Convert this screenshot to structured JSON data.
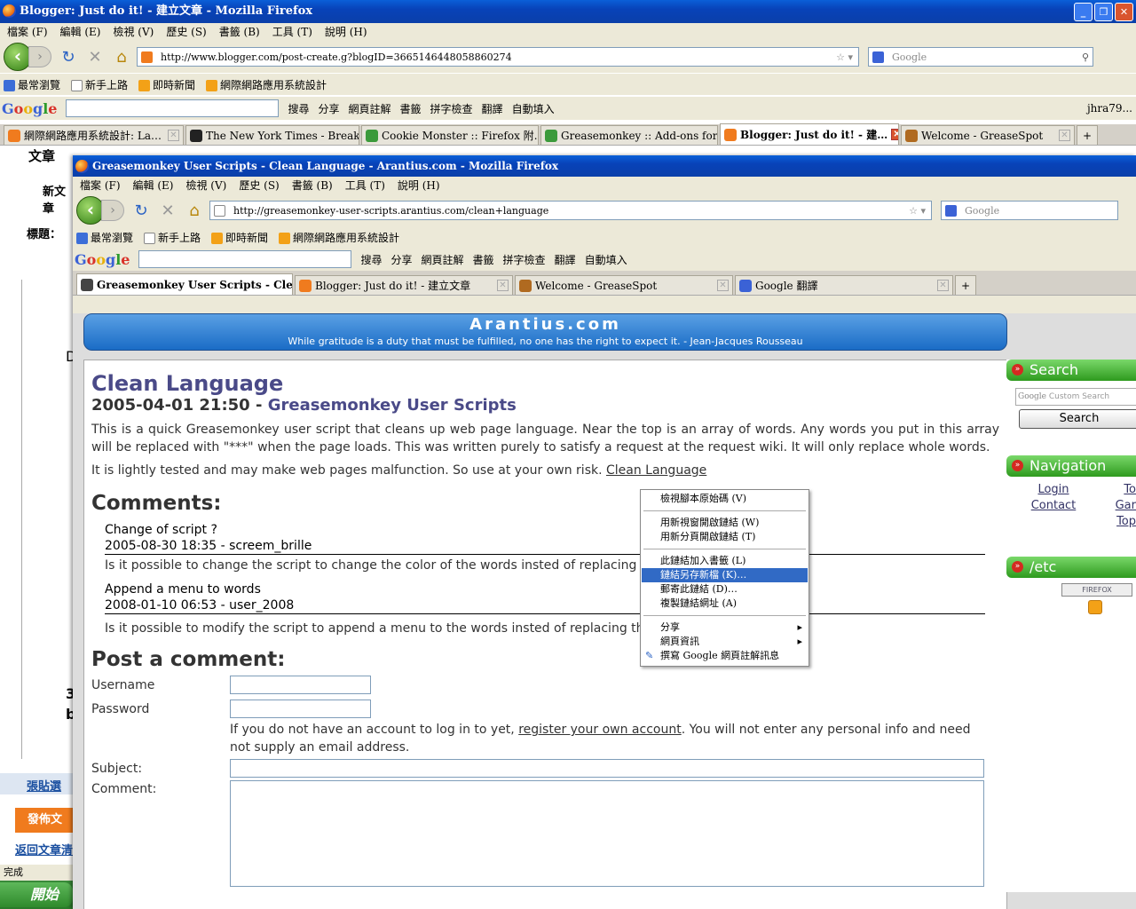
{
  "outer": {
    "title": "Blogger: Just do it! - 建立文章 - Mozilla Firefox",
    "menu": [
      "檔案 (F)",
      "編輯 (E)",
      "檢視 (V)",
      "歷史 (S)",
      "書籤 (B)",
      "工具 (T)",
      "說明 (H)"
    ],
    "url": "http://www.blogger.com/post-create.g?blogID=3665146448058860274",
    "search_placeholder": "Google",
    "bookmarks": [
      "最常瀏覽",
      "新手上路",
      "即時新聞",
      "網際網路應用系統設計"
    ],
    "gtoolbar": [
      "搜尋",
      "分享",
      "網頁註解",
      "書籤",
      "拼字檢查",
      "翻譯",
      "自動填入"
    ],
    "user": "jhra79...",
    "tabs": [
      {
        "label": "網際網路應用系統設計: La…",
        "color": "#f07b1e"
      },
      {
        "label": "The New York Times - Break…",
        "color": "#222222"
      },
      {
        "label": "Cookie Monster :: Firefox 附…",
        "color": "#3b9a3b"
      },
      {
        "label": "Greasemonkey :: Add-ons for…",
        "color": "#3b9a3b"
      },
      {
        "label": "Blogger: Just do it! - 建…",
        "color": "#f07b1e"
      },
      {
        "label": "Welcome - GreaseSpot",
        "color": "#b06a20"
      }
    ],
    "left_fragments": [
      "文章",
      "新文章",
      "標題：",
      "D",
      "3",
      "b",
      "張貼選",
      "發佈文章",
      "返回文章清"
    ],
    "status": "完成",
    "start": "開始"
  },
  "inner": {
    "title": "Greasemonkey User Scripts - Clean Language - Arantius.com - Mozilla Firefox",
    "url": "http://greasemonkey-user-scripts.arantius.com/clean+language",
    "tabs": [
      {
        "label": "Greasemonkey User Scripts - Cle…",
        "color": "#444444"
      },
      {
        "label": "Blogger: Just do it! - 建立文章",
        "color": "#f07b1e"
      },
      {
        "label": "Welcome - GreaseSpot",
        "color": "#b06a20"
      },
      {
        "label": "Google 翻譯",
        "color": "#3b62d6"
      }
    ]
  },
  "page": {
    "site_title": "Arantius.com",
    "site_quote": "While gratitude is a duty that must be fulfilled, no one has the right to expect it. - Jean-Jacques Rousseau",
    "heading": "Clean Language",
    "date": "2005-04-01 21:50 - ",
    "category": "Greasemonkey User Scripts",
    "para1": "This is a quick Greasemonkey user script that cleans up web page language. Near the top is an array of words. Any words you put in this array will be replaced with \"***\" when the page loads. This was written purely to satisfy a request at the request wiki. It will only replace whole words.",
    "para2": "It is lightly tested and may make web pages malfunction. So use at your own risk. ",
    "para2_link": "Clean Language",
    "comments_heading": "Comments:",
    "comments": [
      {
        "title": "Change of script ?",
        "meta": "2005-08-30 18:35 - screem_brille",
        "body": "Is it possible to change the script to change the color of the words insted of replacing them ?"
      },
      {
        "title": "Append a menu to words",
        "meta": "2008-01-10 06:53 - user_2008",
        "body": "Is it possible to modify the script to append a menu to the words insted of replacing them ?"
      }
    ],
    "post_heading": "Post a comment:",
    "username_label": "Username",
    "password_label": "Password",
    "account_note_pre": "If you do not have an account to log in to yet, ",
    "account_link": "register your own account",
    "account_note_post": ". You will not enter any personal info and need not supply an email address.",
    "subject_label": "Subject:",
    "comment_label": "Comment:"
  },
  "sidebar": {
    "search_title": "Search",
    "search_placeholder": "Custom Search",
    "search_button": "Search",
    "nav_title": "Navigation",
    "nav_left": [
      "Login",
      "Contact"
    ],
    "nav_right": [
      "To",
      "Gar",
      "Top"
    ],
    "etc_title": "/etc",
    "firefox_badge": "FIREFOX"
  },
  "context_menu": {
    "items": [
      "檢視腳本原始碼 (V)",
      "用新視窗開啟鏈結 (W)",
      "用新分頁開啟鏈結 (T)",
      "此鏈結加入書籤 (L)",
      "鏈結另存新檔 (K)…",
      "郵寄此鏈結 (D)…",
      "複製鏈結網址 (A)",
      "分享",
      "網頁資訊",
      "撰寫 Google 網頁註解訊息"
    ],
    "selected": "鏈結另存新檔 (K)…"
  }
}
